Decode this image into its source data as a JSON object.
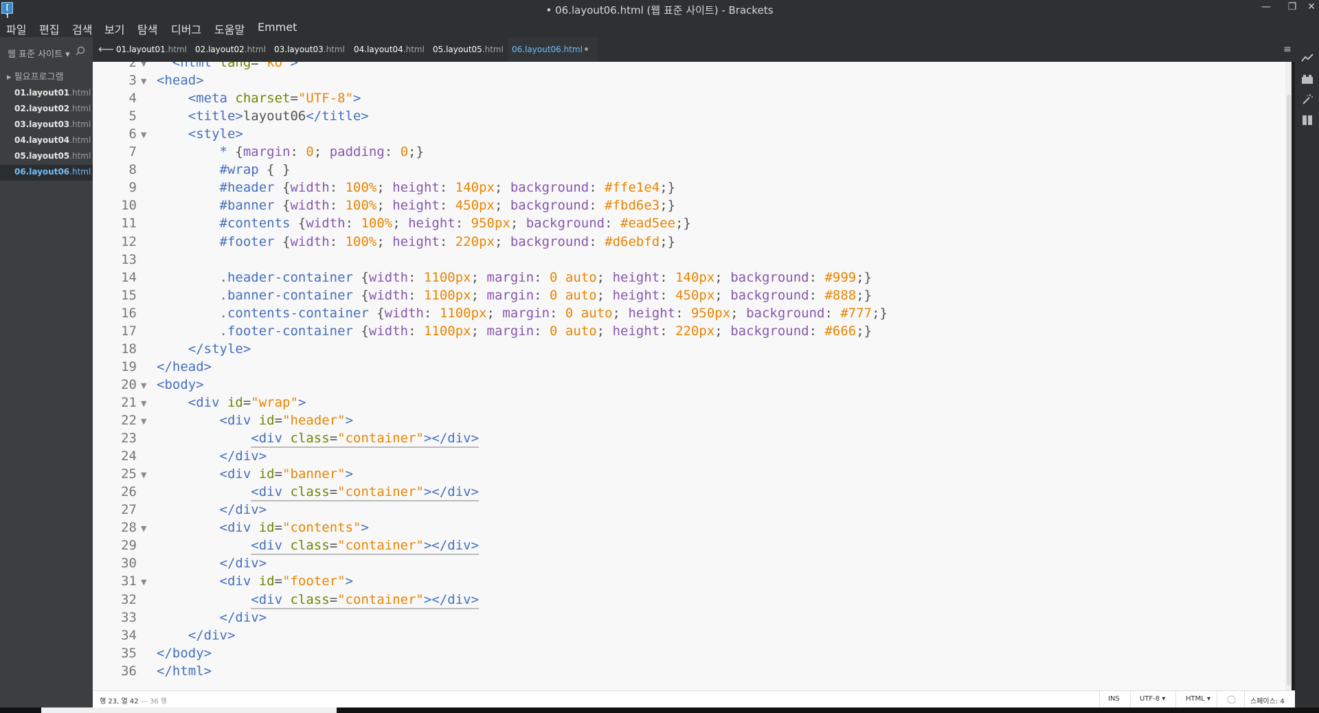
{
  "window": {
    "title": "• 06.layout06.html (웹 표준 사이트) - Brackets",
    "app_icon": "[ ]",
    "minimize_glyph": "—",
    "restore_glyph": "❐",
    "close_glyph": "✕"
  },
  "menu": [
    "파일",
    "편집",
    "검색",
    "보기",
    "탐색",
    "디버그",
    "도움말",
    "Emmet"
  ],
  "sidebar": {
    "project_title": "웹 표준 사이트 ▾",
    "folder": "▸ 필요프로그램",
    "files": [
      {
        "base": "01.layout01",
        "ext": ".html"
      },
      {
        "base": "02.layout02",
        "ext": ".html"
      },
      {
        "base": "03.layout03",
        "ext": ".html"
      },
      {
        "base": "04.layout04",
        "ext": ".html"
      },
      {
        "base": "05.layout05",
        "ext": ".html"
      },
      {
        "base": "06.layout06",
        "ext": ".html"
      }
    ],
    "selected_index": 5
  },
  "tabs": [
    {
      "base": "01.layout01",
      "ext": ".html"
    },
    {
      "base": "02.layout02",
      "ext": ".html"
    },
    {
      "base": "03.layout03",
      "ext": ".html"
    },
    {
      "base": "04.layout04",
      "ext": ".html"
    },
    {
      "base": "05.layout05",
      "ext": ".html"
    },
    {
      "base": "06.layout06",
      "ext": ".html"
    }
  ],
  "active_tab_index": 5,
  "tab_back_glyph": "⟵",
  "tab_menu_glyph": "≡",
  "code_lines": [
    {
      "n": "2",
      "fold": "▼",
      "tokens": [
        [
          "  ",
          "plain"
        ],
        [
          "<html",
          "tag"
        ],
        [
          " lang",
          "attr"
        ],
        [
          "=",
          "plain"
        ],
        [
          "\"ko\"",
          "str"
        ],
        [
          ">",
          "tag"
        ]
      ]
    },
    {
      "n": "3",
      "fold": "▼",
      "tokens": [
        [
          "<head>",
          "tag"
        ]
      ]
    },
    {
      "n": "4",
      "fold": "",
      "tokens": [
        [
          "    <meta",
          "tag"
        ],
        [
          " charset",
          "attr"
        ],
        [
          "=",
          "plain"
        ],
        [
          "\"UTF-8\"",
          "str"
        ],
        [
          ">",
          "tag"
        ]
      ]
    },
    {
      "n": "5",
      "fold": "",
      "tokens": [
        [
          "    <title>",
          "tag"
        ],
        [
          "layout06",
          "plain"
        ],
        [
          "</title>",
          "tag"
        ]
      ]
    },
    {
      "n": "6",
      "fold": "▼",
      "tokens": [
        [
          "    <style>",
          "tag"
        ]
      ]
    },
    {
      "n": "7",
      "fold": "",
      "tokens": [
        [
          "        * ",
          "sel"
        ],
        [
          "{",
          "plain"
        ],
        [
          "margin",
          "prop"
        ],
        [
          ": ",
          "plain"
        ],
        [
          "0",
          "num"
        ],
        [
          "; ",
          "plain"
        ],
        [
          "padding",
          "prop"
        ],
        [
          ": ",
          "plain"
        ],
        [
          "0",
          "num"
        ],
        [
          ";}",
          "plain"
        ]
      ]
    },
    {
      "n": "8",
      "fold": "",
      "tokens": [
        [
          "        #wrap ",
          "sel"
        ],
        [
          "{ }",
          "plain"
        ]
      ]
    },
    {
      "n": "9",
      "fold": "",
      "tokens": [
        [
          "        #header ",
          "sel"
        ],
        [
          "{",
          "plain"
        ],
        [
          "width",
          "prop"
        ],
        [
          ": ",
          "plain"
        ],
        [
          "100%",
          "num"
        ],
        [
          "; ",
          "plain"
        ],
        [
          "height",
          "prop"
        ],
        [
          ": ",
          "plain"
        ],
        [
          "140px",
          "num"
        ],
        [
          "; ",
          "plain"
        ],
        [
          "background",
          "prop"
        ],
        [
          ": ",
          "plain"
        ],
        [
          "#ffe1e4",
          "num"
        ],
        [
          ";}",
          "plain"
        ]
      ]
    },
    {
      "n": "10",
      "fold": "",
      "tokens": [
        [
          "        #banner ",
          "sel"
        ],
        [
          "{",
          "plain"
        ],
        [
          "width",
          "prop"
        ],
        [
          ": ",
          "plain"
        ],
        [
          "100%",
          "num"
        ],
        [
          "; ",
          "plain"
        ],
        [
          "height",
          "prop"
        ],
        [
          ": ",
          "plain"
        ],
        [
          "450px",
          "num"
        ],
        [
          "; ",
          "plain"
        ],
        [
          "background",
          "prop"
        ],
        [
          ": ",
          "plain"
        ],
        [
          "#fbd6e3",
          "num"
        ],
        [
          ";}",
          "plain"
        ]
      ]
    },
    {
      "n": "11",
      "fold": "",
      "tokens": [
        [
          "        #contents ",
          "sel"
        ],
        [
          "{",
          "plain"
        ],
        [
          "width",
          "prop"
        ],
        [
          ": ",
          "plain"
        ],
        [
          "100%",
          "num"
        ],
        [
          "; ",
          "plain"
        ],
        [
          "height",
          "prop"
        ],
        [
          ": ",
          "plain"
        ],
        [
          "950px",
          "num"
        ],
        [
          "; ",
          "plain"
        ],
        [
          "background",
          "prop"
        ],
        [
          ": ",
          "plain"
        ],
        [
          "#ead5ee",
          "num"
        ],
        [
          ";}",
          "plain"
        ]
      ]
    },
    {
      "n": "12",
      "fold": "",
      "tokens": [
        [
          "        #footer ",
          "sel"
        ],
        [
          "{",
          "plain"
        ],
        [
          "width",
          "prop"
        ],
        [
          ": ",
          "plain"
        ],
        [
          "100%",
          "num"
        ],
        [
          "; ",
          "plain"
        ],
        [
          "height",
          "prop"
        ],
        [
          ": ",
          "plain"
        ],
        [
          "220px",
          "num"
        ],
        [
          "; ",
          "plain"
        ],
        [
          "background",
          "prop"
        ],
        [
          ": ",
          "plain"
        ],
        [
          "#d6ebfd",
          "num"
        ],
        [
          ";}",
          "plain"
        ]
      ]
    },
    {
      "n": "13",
      "fold": "",
      "tokens": [
        [
          "",
          "plain"
        ]
      ]
    },
    {
      "n": "14",
      "fold": "",
      "tokens": [
        [
          "        .header-container ",
          "sel"
        ],
        [
          "{",
          "plain"
        ],
        [
          "width",
          "prop"
        ],
        [
          ": ",
          "plain"
        ],
        [
          "1100px",
          "num"
        ],
        [
          "; ",
          "plain"
        ],
        [
          "margin",
          "prop"
        ],
        [
          ": ",
          "plain"
        ],
        [
          "0 auto",
          "num"
        ],
        [
          "; ",
          "plain"
        ],
        [
          "height",
          "prop"
        ],
        [
          ": ",
          "plain"
        ],
        [
          "140px",
          "num"
        ],
        [
          "; ",
          "plain"
        ],
        [
          "background",
          "prop"
        ],
        [
          ": ",
          "plain"
        ],
        [
          "#999",
          "num"
        ],
        [
          ";}",
          "plain"
        ]
      ]
    },
    {
      "n": "15",
      "fold": "",
      "tokens": [
        [
          "        .banner-container ",
          "sel"
        ],
        [
          "{",
          "plain"
        ],
        [
          "width",
          "prop"
        ],
        [
          ": ",
          "plain"
        ],
        [
          "1100px",
          "num"
        ],
        [
          "; ",
          "plain"
        ],
        [
          "margin",
          "prop"
        ],
        [
          ": ",
          "plain"
        ],
        [
          "0 auto",
          "num"
        ],
        [
          "; ",
          "plain"
        ],
        [
          "height",
          "prop"
        ],
        [
          ": ",
          "plain"
        ],
        [
          "450px",
          "num"
        ],
        [
          "; ",
          "plain"
        ],
        [
          "background",
          "prop"
        ],
        [
          ": ",
          "plain"
        ],
        [
          "#888",
          "num"
        ],
        [
          ";}",
          "plain"
        ]
      ]
    },
    {
      "n": "16",
      "fold": "",
      "tokens": [
        [
          "        .contents-container ",
          "sel"
        ],
        [
          "{",
          "plain"
        ],
        [
          "width",
          "prop"
        ],
        [
          ": ",
          "plain"
        ],
        [
          "1100px",
          "num"
        ],
        [
          "; ",
          "plain"
        ],
        [
          "margin",
          "prop"
        ],
        [
          ": ",
          "plain"
        ],
        [
          "0 auto",
          "num"
        ],
        [
          "; ",
          "plain"
        ],
        [
          "height",
          "prop"
        ],
        [
          ": ",
          "plain"
        ],
        [
          "950px",
          "num"
        ],
        [
          "; ",
          "plain"
        ],
        [
          "background",
          "prop"
        ],
        [
          ": ",
          "plain"
        ],
        [
          "#777",
          "num"
        ],
        [
          ";}",
          "plain"
        ]
      ]
    },
    {
      "n": "17",
      "fold": "",
      "tokens": [
        [
          "        .footer-container ",
          "sel"
        ],
        [
          "{",
          "plain"
        ],
        [
          "width",
          "prop"
        ],
        [
          ": ",
          "plain"
        ],
        [
          "1100px",
          "num"
        ],
        [
          "; ",
          "plain"
        ],
        [
          "margin",
          "prop"
        ],
        [
          ": ",
          "plain"
        ],
        [
          "0 auto",
          "num"
        ],
        [
          "; ",
          "plain"
        ],
        [
          "height",
          "prop"
        ],
        [
          ": ",
          "plain"
        ],
        [
          "220px",
          "num"
        ],
        [
          "; ",
          "plain"
        ],
        [
          "background",
          "prop"
        ],
        [
          ": ",
          "plain"
        ],
        [
          "#666",
          "num"
        ],
        [
          ";}",
          "plain"
        ]
      ]
    },
    {
      "n": "18",
      "fold": "",
      "tokens": [
        [
          "    </style>",
          "tag"
        ]
      ]
    },
    {
      "n": "19",
      "fold": "",
      "tokens": [
        [
          "</head>",
          "tag"
        ]
      ]
    },
    {
      "n": "20",
      "fold": "▼",
      "tokens": [
        [
          "<body>",
          "tag"
        ]
      ]
    },
    {
      "n": "21",
      "fold": "▼",
      "tokens": [
        [
          "    <div",
          "tag"
        ],
        [
          " id",
          "attr"
        ],
        [
          "=",
          "plain"
        ],
        [
          "\"wrap\"",
          "str"
        ],
        [
          ">",
          "tag"
        ]
      ]
    },
    {
      "n": "22",
      "fold": "▼",
      "tokens": [
        [
          "        <div",
          "tag"
        ],
        [
          " id",
          "attr"
        ],
        [
          "=",
          "plain"
        ],
        [
          "\"header\"",
          "str"
        ],
        [
          ">",
          "tag"
        ]
      ]
    },
    {
      "n": "23",
      "fold": "",
      "squiggle": true,
      "tokens": [
        [
          "            ",
          "plain"
        ],
        [
          "<div",
          "tag"
        ],
        [
          " class",
          "attr"
        ],
        [
          "=",
          "plain"
        ],
        [
          "\"container\"",
          "str"
        ],
        [
          "></div>",
          "tag"
        ]
      ]
    },
    {
      "n": "24",
      "fold": "",
      "tokens": [
        [
          "        </div>",
          "tag"
        ]
      ]
    },
    {
      "n": "25",
      "fold": "▼",
      "tokens": [
        [
          "        <div",
          "tag"
        ],
        [
          " id",
          "attr"
        ],
        [
          "=",
          "plain"
        ],
        [
          "\"banner\"",
          "str"
        ],
        [
          ">",
          "tag"
        ]
      ]
    },
    {
      "n": "26",
      "fold": "",
      "squiggle": true,
      "tokens": [
        [
          "            ",
          "plain"
        ],
        [
          "<div",
          "tag"
        ],
        [
          " class",
          "attr"
        ],
        [
          "=",
          "plain"
        ],
        [
          "\"container\"",
          "str"
        ],
        [
          "></div>",
          "tag"
        ]
      ]
    },
    {
      "n": "27",
      "fold": "",
      "tokens": [
        [
          "        </div>",
          "tag"
        ]
      ]
    },
    {
      "n": "28",
      "fold": "▼",
      "tokens": [
        [
          "        <div",
          "tag"
        ],
        [
          " id",
          "attr"
        ],
        [
          "=",
          "plain"
        ],
        [
          "\"contents\"",
          "str"
        ],
        [
          ">",
          "tag"
        ]
      ]
    },
    {
      "n": "29",
      "fold": "",
      "squiggle": true,
      "tokens": [
        [
          "            ",
          "plain"
        ],
        [
          "<div",
          "tag"
        ],
        [
          " class",
          "attr"
        ],
        [
          "=",
          "plain"
        ],
        [
          "\"container\"",
          "str"
        ],
        [
          "></div>",
          "tag"
        ]
      ]
    },
    {
      "n": "30",
      "fold": "",
      "tokens": [
        [
          "        </div>",
          "tag"
        ]
      ]
    },
    {
      "n": "31",
      "fold": "▼",
      "tokens": [
        [
          "        <div",
          "tag"
        ],
        [
          " id",
          "attr"
        ],
        [
          "=",
          "plain"
        ],
        [
          "\"footer\"",
          "str"
        ],
        [
          ">",
          "tag"
        ]
      ]
    },
    {
      "n": "32",
      "fold": "",
      "squiggle": true,
      "tokens": [
        [
          "            ",
          "plain"
        ],
        [
          "<div",
          "tag"
        ],
        [
          " class",
          "attr"
        ],
        [
          "=",
          "plain"
        ],
        [
          "\"container\"",
          "str"
        ],
        [
          "></div>",
          "tag"
        ]
      ]
    },
    {
      "n": "33",
      "fold": "",
      "tokens": [
        [
          "        </div>",
          "tag"
        ]
      ]
    },
    {
      "n": "34",
      "fold": "",
      "tokens": [
        [
          "    </div>",
          "tag"
        ]
      ]
    },
    {
      "n": "35",
      "fold": "",
      "tokens": [
        [
          "</body>",
          "tag"
        ]
      ]
    },
    {
      "n": "36",
      "fold": "",
      "tokens": [
        [
          "</html>",
          "tag"
        ]
      ]
    }
  ],
  "status": {
    "cursor": "행 23, 열 42",
    "line_count": "— 36 행",
    "mode": "INS",
    "encoding": "UTF-8 ▾",
    "language": "HTML ▾",
    "spaces": "스페이스: 4"
  },
  "colors": {
    "tag": "#446fbd",
    "attr": "#6d8600",
    "string": "#e88501",
    "property": "#8757ad",
    "active_file": "#72bdf8"
  },
  "right_toolbar_icons": [
    "live-preview-icon",
    "extension-manager-icon",
    "wand-icon",
    "book-icon"
  ]
}
